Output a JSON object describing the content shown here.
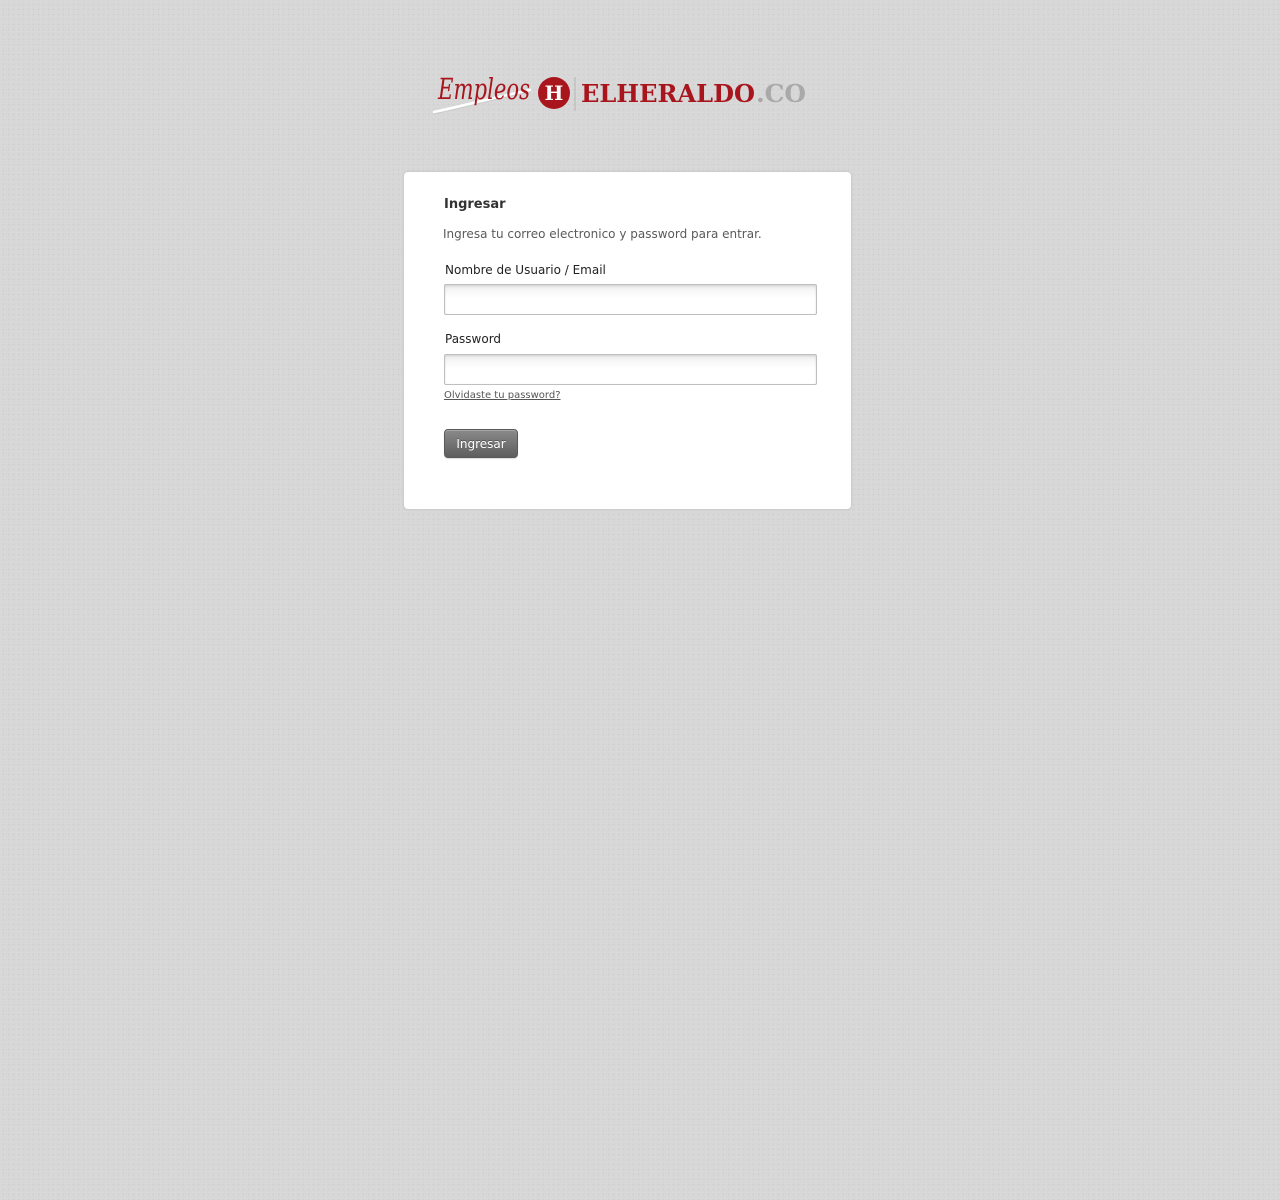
{
  "logo": {
    "script_word": "Empleos",
    "emblem_letter": "H",
    "brand_name": "ELHERALDO",
    "domain_suffix": ".CO",
    "colors": {
      "brand_red": "#a8151c",
      "suffix_gray": "#a9a9a9",
      "divider_gray": "#b5b5b5"
    }
  },
  "login": {
    "title": "Ingresar",
    "intro": "Ingresa tu correo electronico y password para entrar.",
    "username": {
      "label": "Nombre de Usuario / Email",
      "value": "",
      "placeholder": ""
    },
    "password": {
      "label": "Password",
      "value": "",
      "placeholder": ""
    },
    "forgot_link": "Olvidaste tu password?",
    "submit_label": "Ingresar"
  },
  "theme": {
    "page_background": "#d7d7d7",
    "card_background": "#ffffff",
    "button_color": "#6e6e6e"
  }
}
